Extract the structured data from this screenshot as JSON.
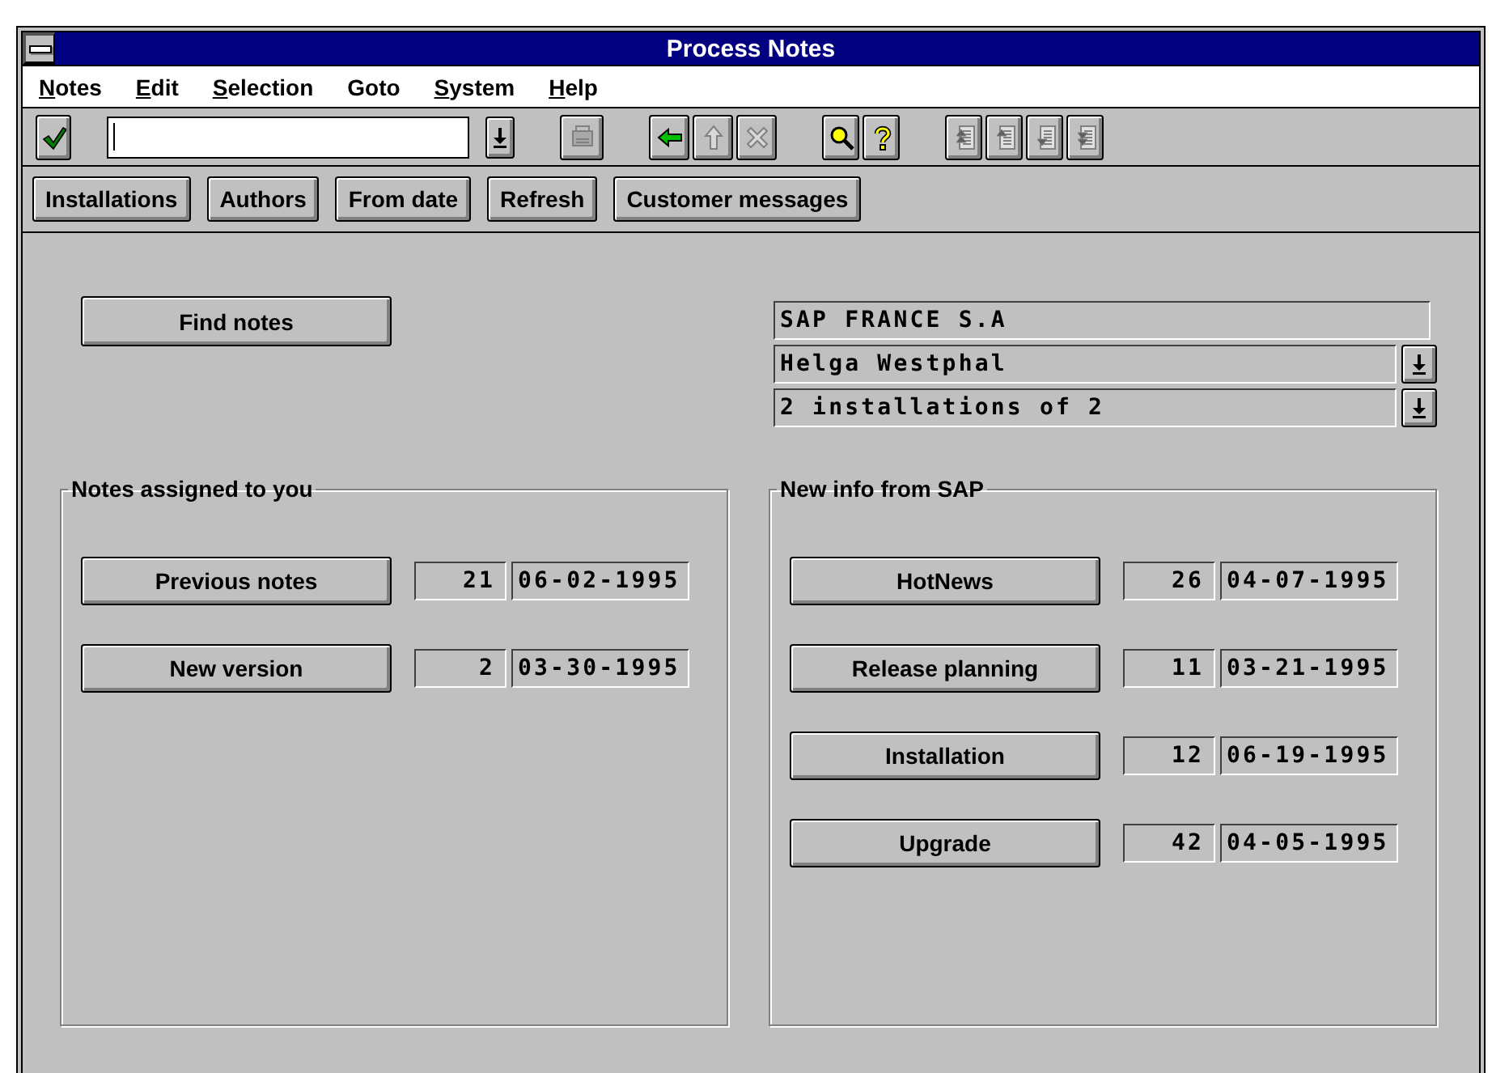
{
  "window": {
    "title": "Process Notes"
  },
  "menu": [
    {
      "label": "Notes",
      "mnemonic": true
    },
    {
      "label": "Edit",
      "mnemonic": true
    },
    {
      "label": "Selection",
      "mnemonic": true
    },
    {
      "label": "Goto",
      "mnemonic": false
    },
    {
      "label": "System",
      "mnemonic": true
    },
    {
      "label": "Help",
      "mnemonic": true
    }
  ],
  "toolbar": {
    "enter": {
      "kind": "check",
      "disabled": false
    },
    "groups": [
      [
        {
          "kind": "save",
          "disabled": true
        }
      ],
      [
        {
          "kind": "back",
          "disabled": false
        },
        {
          "kind": "up",
          "disabled": true
        },
        {
          "kind": "cancel",
          "disabled": true
        }
      ],
      [
        {
          "kind": "find",
          "disabled": false
        },
        {
          "kind": "help",
          "disabled": false
        }
      ],
      [
        {
          "kind": "first-page",
          "disabled": true
        },
        {
          "kind": "previous-page",
          "disabled": true
        },
        {
          "kind": "next-page",
          "disabled": true
        },
        {
          "kind": "last-page",
          "disabled": true
        }
      ]
    ]
  },
  "app_toolbar": [
    "Installations",
    "Authors",
    "From date",
    "Refresh",
    "Customer messages"
  ],
  "find_button": "Find notes",
  "info_fields": [
    {
      "value": "SAP FRANCE S.A",
      "dropdown": false
    },
    {
      "value": "Helga Westphal",
      "dropdown": true
    },
    {
      "value": "2 installations of 2",
      "dropdown": true
    }
  ],
  "groups": [
    {
      "title": "Notes assigned to you",
      "rows": [
        {
          "label": "Previous notes",
          "count": "21",
          "date": "06-02-1995"
        },
        {
          "label": "New version",
          "count": "2",
          "date": "03-30-1995"
        }
      ]
    },
    {
      "title": "New info from SAP",
      "rows": [
        {
          "label": "HotNews",
          "count": "26",
          "date": "04-07-1995"
        },
        {
          "label": "Release planning",
          "count": "11",
          "date": "03-21-1995"
        },
        {
          "label": "Installation",
          "count": "12",
          "date": "06-19-1995"
        },
        {
          "label": "Upgrade",
          "count": "42",
          "date": "04-05-1995"
        }
      ]
    }
  ]
}
